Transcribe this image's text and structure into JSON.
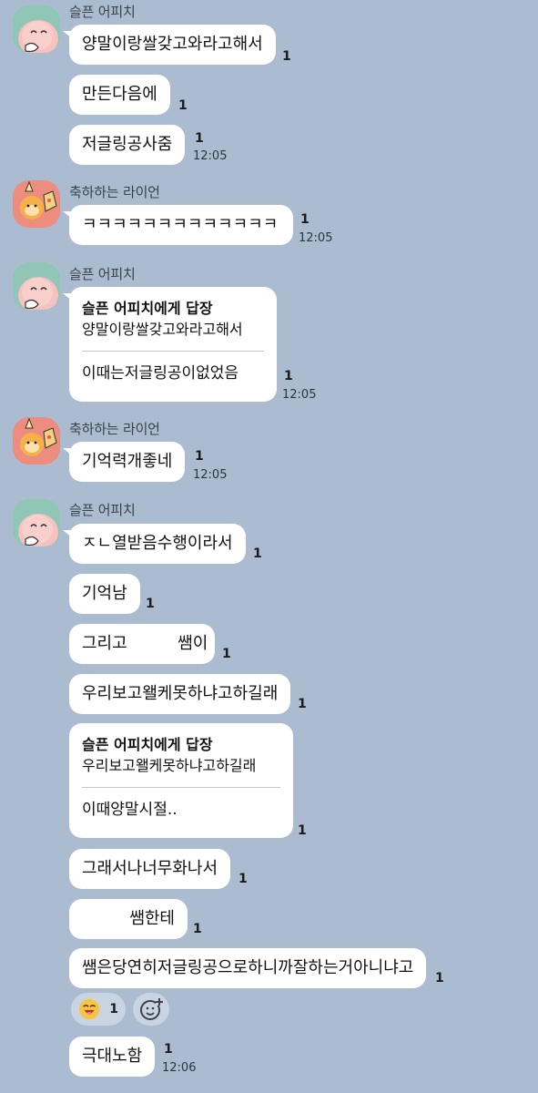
{
  "senders": {
    "peach": "슬픈 어피치",
    "lion": "축하하는 라이언"
  },
  "messages": {
    "m1": {
      "text": "양말이랑쌀갖고와라고해서",
      "unread": "1"
    },
    "m2": {
      "text": "만든다음에",
      "unread": "1"
    },
    "m3": {
      "text": "저글링공사줌",
      "unread": "1",
      "time": "12:05"
    },
    "m4": {
      "text": "ㅋㅋㅋㅋㅋㅋㅋㅋㅋㅋㅋㅋㅋ",
      "unread": "1",
      "time": "12:05"
    },
    "m5": {
      "reply_to": "슬픈 어피치에게 답장",
      "quoted": "양말이랑쌀갖고와라고해서",
      "text": "이때는저글링공이없었음",
      "unread": "1",
      "time": "12:05"
    },
    "m6": {
      "text": "기억력개좋네",
      "unread": "1",
      "time": "12:05"
    },
    "m7": {
      "text": "ㅈㄴ열받음수행이라서",
      "unread": "1"
    },
    "m8": {
      "text": "기억남",
      "unread": "1"
    },
    "m9": {
      "text_a": "그리고",
      "text_b": "쌤이",
      "unread": "1"
    },
    "m10": {
      "text": "우리보고왤케못하냐고하길래",
      "unread": "1"
    },
    "m11": {
      "reply_to": "슬픈 어피치에게 답장",
      "quoted": "우리보고왤케못하냐고하길래",
      "text": "이때양말시절..",
      "unread": "1"
    },
    "m12": {
      "text": "그래서나너무화나서",
      "unread": "1"
    },
    "m13": {
      "text": "쌤한테",
      "unread": "1"
    },
    "m14": {
      "text": "쌤은당연히저글링공으로하니까잘하는거아니냐고",
      "unread": "1"
    },
    "reaction": {
      "emoji_name": "laughing-face-icon",
      "count": "1"
    },
    "m15": {
      "text": "극대노함",
      "unread": "1",
      "time": "12:06"
    }
  }
}
